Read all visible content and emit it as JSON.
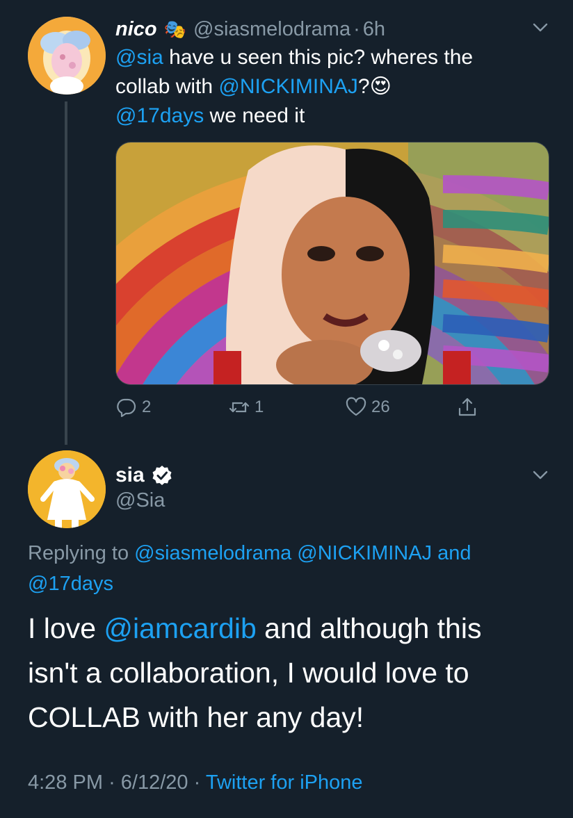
{
  "tweet1": {
    "author_name": "nico",
    "name_emoji": "🎭",
    "handle": "@siasmelodrama",
    "separator": "·",
    "age": "6h",
    "text": {
      "mention_sia": "@sia",
      "part1": " have u seen this pic? wheres the",
      "part2": "collab with ",
      "mention_nicki": "@NICKIMINAJ",
      "part3": "?",
      "emoji": "😍",
      "mention_17days": "@17days",
      "part4": " we need it"
    },
    "actions": {
      "replies": "2",
      "retweets": "1",
      "likes": "26"
    }
  },
  "tweet2": {
    "author_name": "sia",
    "handle": "@Sia",
    "replying_prefix": "Replying to ",
    "replying_to": [
      "@siasmelodrama",
      "@NICKIMINAJ"
    ],
    "replying_and": "and",
    "replying_last": "@17days",
    "body": {
      "l1_a": "I love ",
      "l1_mention": "@iamcardib",
      "l1_b": " and although this",
      "l2": "isn't a collaboration, I would love to",
      "l3": "COLLAB with her any day!"
    },
    "meta": {
      "time": "4:28 PM",
      "date": "6/12/20",
      "separator": "·",
      "client": "Twitter for iPhone"
    }
  },
  "icons": [
    "chevron-down-icon",
    "reply-icon",
    "retweet-icon",
    "like-icon",
    "share-icon",
    "verified-badge-icon"
  ],
  "colors": {
    "background": "#15202b",
    "link": "#1da1f2",
    "muted": "#8899a6",
    "divider": "#38444d"
  }
}
